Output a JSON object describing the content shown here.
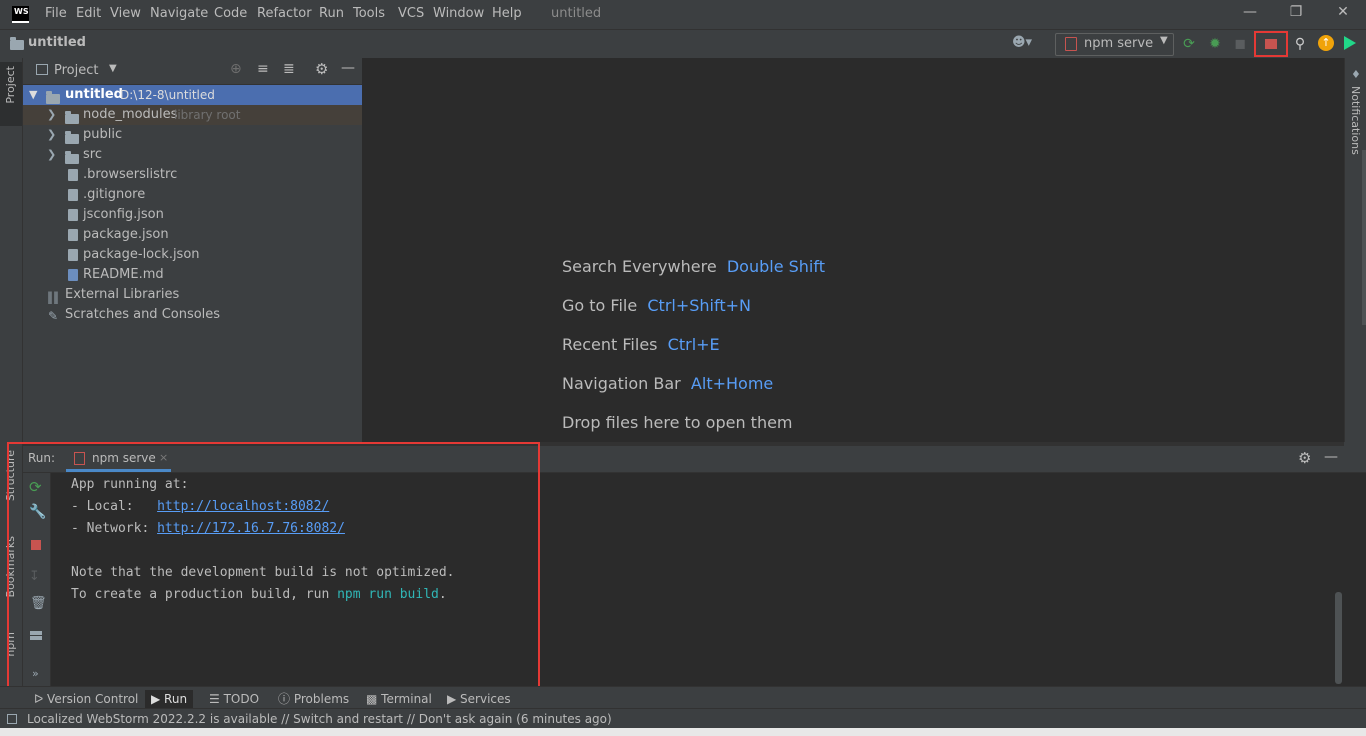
{
  "app": {
    "logo": "WS",
    "window_title": "untitled"
  },
  "menu": [
    "File",
    "Edit",
    "View",
    "Navigate",
    "Code",
    "Refactor",
    "Run",
    "Tools",
    "VCS",
    "Window",
    "Help"
  ],
  "window_controls": {
    "minimize": "—",
    "restore": "❐",
    "close": "✕"
  },
  "navbar": {
    "project_name": "untitled",
    "run_config": "npm serve"
  },
  "project_panel": {
    "title": "Project",
    "tree": [
      {
        "label": "untitled",
        "hint": "D:\\12-8\\untitled",
        "level": 0,
        "type": "folder",
        "expanded": true,
        "selected": true
      },
      {
        "label": "node_modules",
        "hint": "library root",
        "level": 1,
        "type": "folder",
        "expanded": false
      },
      {
        "label": "public",
        "hint": "",
        "level": 1,
        "type": "folder",
        "expanded": false
      },
      {
        "label": "src",
        "hint": "",
        "level": 1,
        "type": "folder",
        "expanded": false
      },
      {
        "label": ".browserslistrc",
        "hint": "",
        "level": 1,
        "type": "file"
      },
      {
        "label": ".gitignore",
        "hint": "",
        "level": 1,
        "type": "file"
      },
      {
        "label": "jsconfig.json",
        "hint": "",
        "level": 1,
        "type": "file"
      },
      {
        "label": "package.json",
        "hint": "",
        "level": 1,
        "type": "file"
      },
      {
        "label": "package-lock.json",
        "hint": "",
        "level": 1,
        "type": "file"
      },
      {
        "label": "README.md",
        "hint": "",
        "level": 1,
        "type": "file"
      },
      {
        "label": "External Libraries",
        "hint": "",
        "level": 0,
        "type": "library"
      },
      {
        "label": "Scratches and Consoles",
        "hint": "",
        "level": 0,
        "type": "scratch"
      }
    ]
  },
  "editor_hints": [
    {
      "text": "Search Everywhere",
      "key": "Double Shift"
    },
    {
      "text": "Go to File",
      "key": "Ctrl+Shift+N"
    },
    {
      "text": "Recent Files",
      "key": "Ctrl+E"
    },
    {
      "text": "Navigation Bar",
      "key": "Alt+Home"
    },
    {
      "text": "Drop files here to open them",
      "key": ""
    }
  ],
  "left_stripe": {
    "project": "Project",
    "structure": "Structure",
    "bookmarks": "Bookmarks",
    "npm": "npm"
  },
  "right_stripe": {
    "notifications": "Notifications"
  },
  "run_panel": {
    "label": "Run:",
    "tab": "npm serve",
    "console": {
      "line1": "App running at:",
      "local_label": "- Local:   ",
      "local_url": "http://localhost:8082/",
      "network_label": "- Network: ",
      "network_url": "http://172.16.7.76:8082/",
      "note": "Note that the development build is not optimized.",
      "prod_prefix": "To create a production build, run ",
      "prod_cmd": "npm run build",
      "prod_suffix": "."
    }
  },
  "bottom_tabs": [
    "Version Control",
    "Run",
    "TODO",
    "Problems",
    "Terminal",
    "Services"
  ],
  "status": {
    "message": "Localized WebStorm 2022.2.2 is available // Switch and restart // Don't ask again (6 minutes ago)"
  },
  "colors": {
    "accent": "#589df6",
    "highlight_box": "#e53935",
    "selection": "#4b6eaf",
    "library_row": "#45403a"
  }
}
